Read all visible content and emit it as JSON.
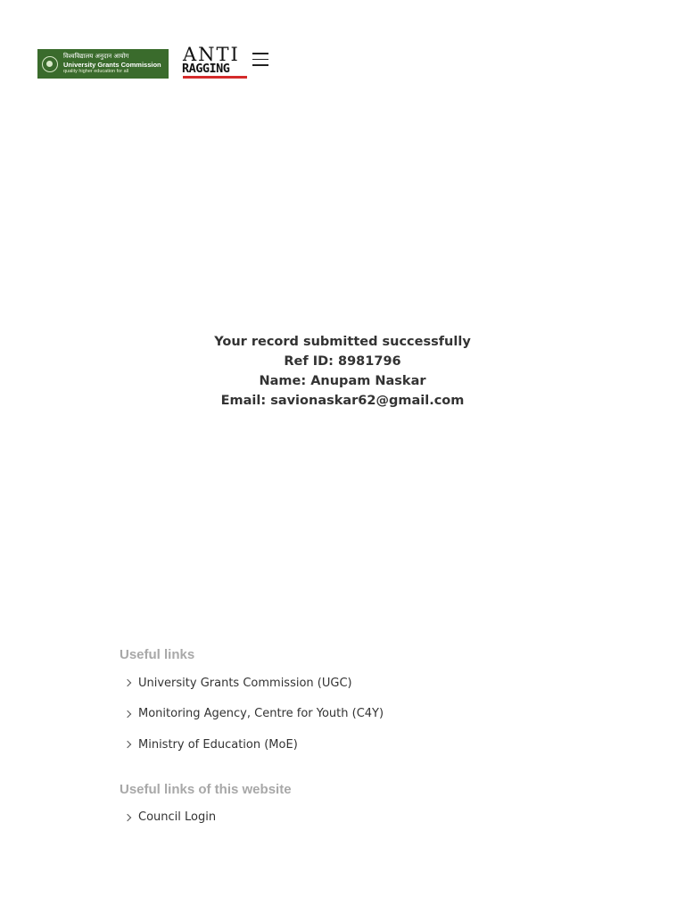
{
  "header": {
    "ugc_logo": {
      "hindi_text": "विश्वविद्यालय अनुदान आयोग",
      "name": "University Grants Commission",
      "tagline": "quality higher education for all"
    },
    "anti_logo": {
      "top": "ANTI",
      "bottom": "RAGGING"
    },
    "menu_icon": "hamburger-menu-icon"
  },
  "message": {
    "line1": "Your record submitted successfully",
    "ref_id": "Ref ID: 8981796",
    "name": "Name: Anupam Naskar",
    "email": "Email: savionaskar62@gmail.com"
  },
  "footer": {
    "useful_links": {
      "title": "Useful links",
      "items": [
        {
          "label": "University Grants Commission (UGC)"
        },
        {
          "label": "Monitoring Agency, Centre for Youth (C4Y)"
        },
        {
          "label": "Ministry of Education (MoE)"
        }
      ]
    },
    "site_links": {
      "title": "Useful links of this website",
      "items": [
        {
          "label": "Council Login"
        }
      ]
    }
  },
  "colors": {
    "ugc_green": "#3a6b2c",
    "anti_red": "#d42a2a",
    "section_title_grey": "#a8a8a8",
    "text": "#333333"
  }
}
